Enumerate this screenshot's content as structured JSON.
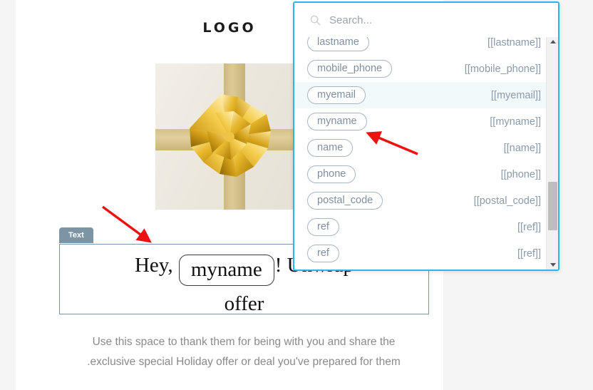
{
  "email": {
    "logo": "LOGO",
    "image_alt": "gold-gift-bow",
    "block_badge": "Text",
    "headline_prefix": "Hey,",
    "headline_token": "myname",
    "headline_suffix": "! Unwrap",
    "headline_line2": "offer",
    "body_line1": "Use this space to thank them for being with you and share the",
    "body_line2": ".exclusive special Holiday offer or deal you've prepared for them"
  },
  "dropdown": {
    "search_placeholder": "Search...",
    "rows": [
      {
        "name": "lastname",
        "value": "[[lastname]]",
        "selected": false
      },
      {
        "name": "mobile_phone",
        "value": "[[mobile_phone]]",
        "selected": false
      },
      {
        "name": "myemail",
        "value": "[[myemail]]",
        "selected": true
      },
      {
        "name": "myname",
        "value": "[[myname]]",
        "selected": false
      },
      {
        "name": "name",
        "value": "[[name]]",
        "selected": false
      },
      {
        "name": "phone",
        "value": "[[phone]]",
        "selected": false
      },
      {
        "name": "postal_code",
        "value": "[[postal_code]]",
        "selected": false
      },
      {
        "name": "ref",
        "value": "[[ref]]",
        "selected": false
      },
      {
        "name": "ref",
        "value": "[[ref]]",
        "selected": false
      }
    ],
    "scroll_up_icon": "triangle-up-icon",
    "scroll_down_icon": "triangle-down-icon"
  },
  "colors": {
    "panel_border": "#29b6e8",
    "pill_border": "#a5b6c6",
    "pill_text": "#7f8fa0",
    "badge_bg": "#7d94a4",
    "annotation": "#ee1111",
    "page_gray": "#f5f5f5",
    "ribbon_gold": "#d3bd84"
  }
}
